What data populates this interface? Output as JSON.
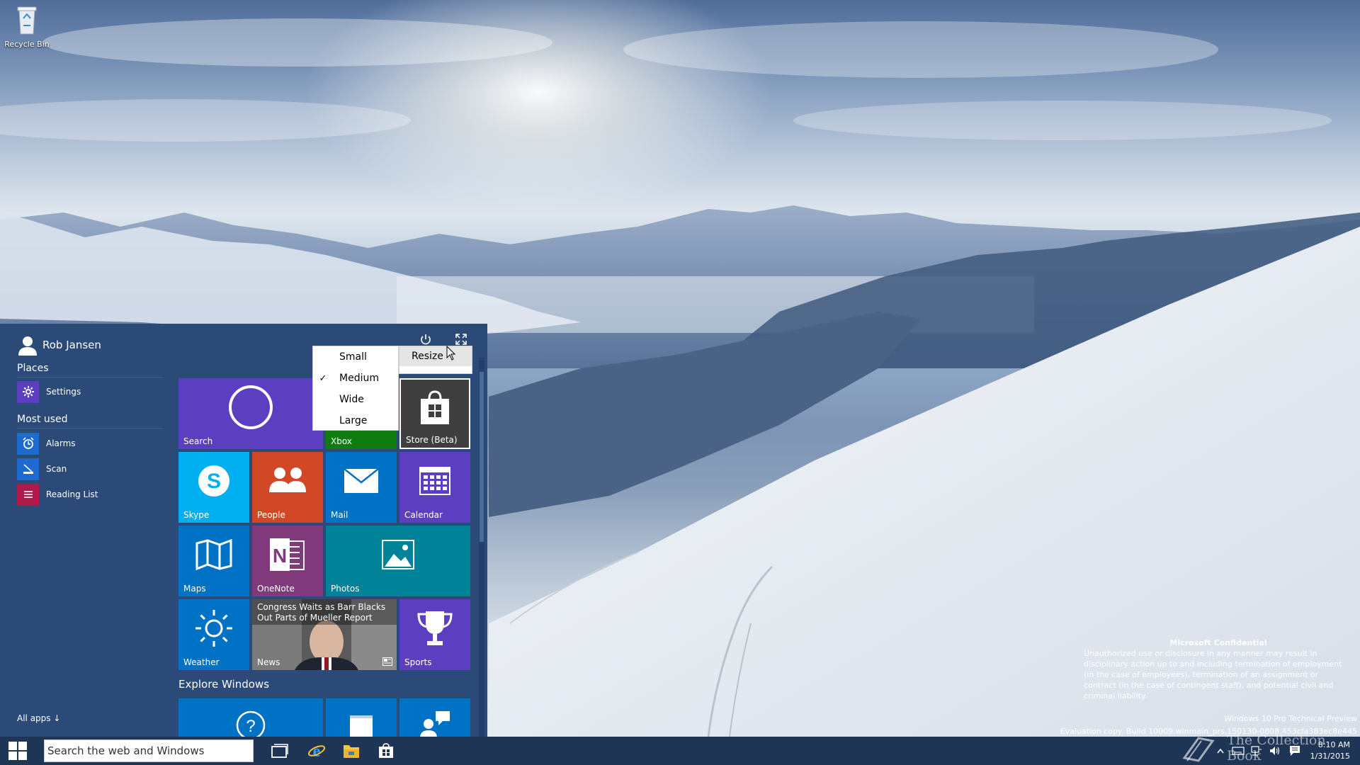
{
  "desktop": {
    "recycle_bin_label": "Recycle Bin",
    "confidential_title": "Microsoft Confidential",
    "confidential_body": "Unauthorized use or disclosure in any manner may result in disciplinary action up to and including termination of employment (in the case of employees), termination of an assignment or contract (in the case of contingent staff), and potential civil and criminal liability.",
    "edition": "Windows 10 Pro Technical Preview",
    "build": "Evaluation copy. Build 10009.winmain_prs.150130-0808.453cfa383ec8e445",
    "brand_watermark": "The Collection Book"
  },
  "start_menu": {
    "user_name": "Rob Jansen",
    "places_title": "Places",
    "places": [
      {
        "label": "Settings",
        "icon": "gear-icon",
        "color": "#5c3fc1"
      }
    ],
    "most_used_title": "Most used",
    "most_used": [
      {
        "label": "Alarms",
        "icon": "alarm-clock-icon",
        "color": "#1d6bd1"
      },
      {
        "label": "Scan",
        "icon": "scanner-icon",
        "color": "#1d6bd1"
      },
      {
        "label": "Reading List",
        "icon": "reading-list-icon",
        "color": "#b0184a"
      }
    ],
    "all_apps": "All apps ↓",
    "explore_title": "Explore Windows",
    "tiles": {
      "search": "Search",
      "xbox": "Xbox",
      "store": "Store (Beta)",
      "skype": "Skype",
      "people": "People",
      "mail": "Mail",
      "calendar": "Calendar",
      "maps": "Maps",
      "onenote": "OneNote",
      "photos": "Photos",
      "weather": "Weather",
      "news": "News",
      "news_headline": "Congress Waits as Barr Blacks Out Parts of Mueller Report",
      "sports": "Sports"
    },
    "tile_colors": {
      "purple": "#5c3fc1",
      "green": "#107c10",
      "store": "#3f3f3f",
      "skype": "#00aff0",
      "people": "#d24726",
      "blue": "#0072c6",
      "onenote": "#80397b",
      "teal": "#008299",
      "explore": "#0072c6"
    }
  },
  "size_menu": {
    "options": [
      "Small",
      "Medium",
      "Wide",
      "Large"
    ],
    "selected": "Medium",
    "check_glyph": "✓"
  },
  "context_menu": {
    "resize": "Resize"
  },
  "taskbar": {
    "search_placeholder": "Search the web and Windows",
    "time": "8:10 AM",
    "date": "1/31/2015"
  }
}
